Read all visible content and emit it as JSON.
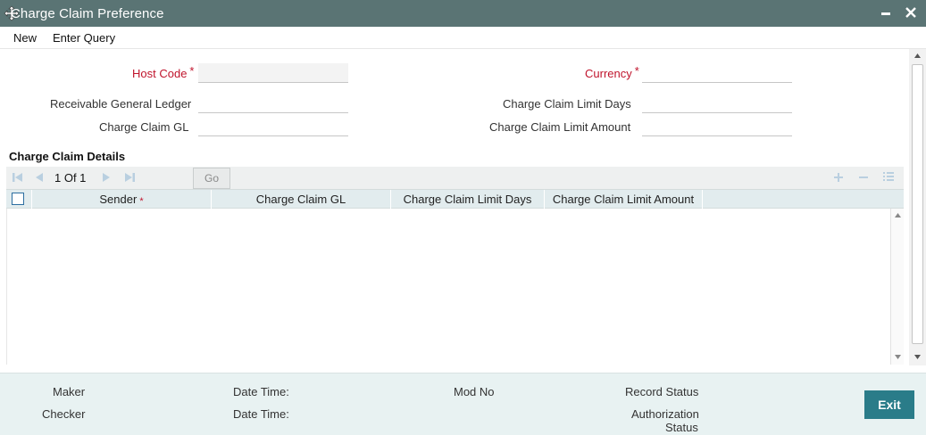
{
  "window": {
    "title": "Charge Claim Preference"
  },
  "menu": {
    "items": [
      "New",
      "Enter Query"
    ]
  },
  "form": {
    "host_code": {
      "label": "Host Code",
      "value": ""
    },
    "currency": {
      "label": "Currency",
      "value": ""
    },
    "receivable_gl": {
      "label": "Receivable General Ledger",
      "value": ""
    },
    "limit_days": {
      "label": "Charge Claim Limit Days",
      "value": ""
    },
    "claim_gl": {
      "label": "Charge Claim GL",
      "value": ""
    },
    "limit_amount": {
      "label": "Charge Claim Limit Amount",
      "value": ""
    }
  },
  "details": {
    "title": "Charge Claim Details",
    "pager": "1 Of 1",
    "go_label": "Go",
    "columns": [
      "Sender",
      "Charge Claim GL",
      "Charge Claim Limit Days",
      "Charge Claim Limit Amount"
    ],
    "rows": []
  },
  "footer": {
    "maker": "Maker",
    "checker": "Checker",
    "date_time_1": "Date Time:",
    "date_time_2": "Date Time:",
    "mod_no": "Mod No",
    "record_status": "Record Status",
    "auth_status_line1": "Authorization",
    "auth_status_line2": "Status",
    "exit_label": "Exit"
  },
  "colors": {
    "titlebar": "#5a7474",
    "required": "#c0142c",
    "exit_button": "#2a7c89",
    "footer": "#e8f2f2"
  }
}
